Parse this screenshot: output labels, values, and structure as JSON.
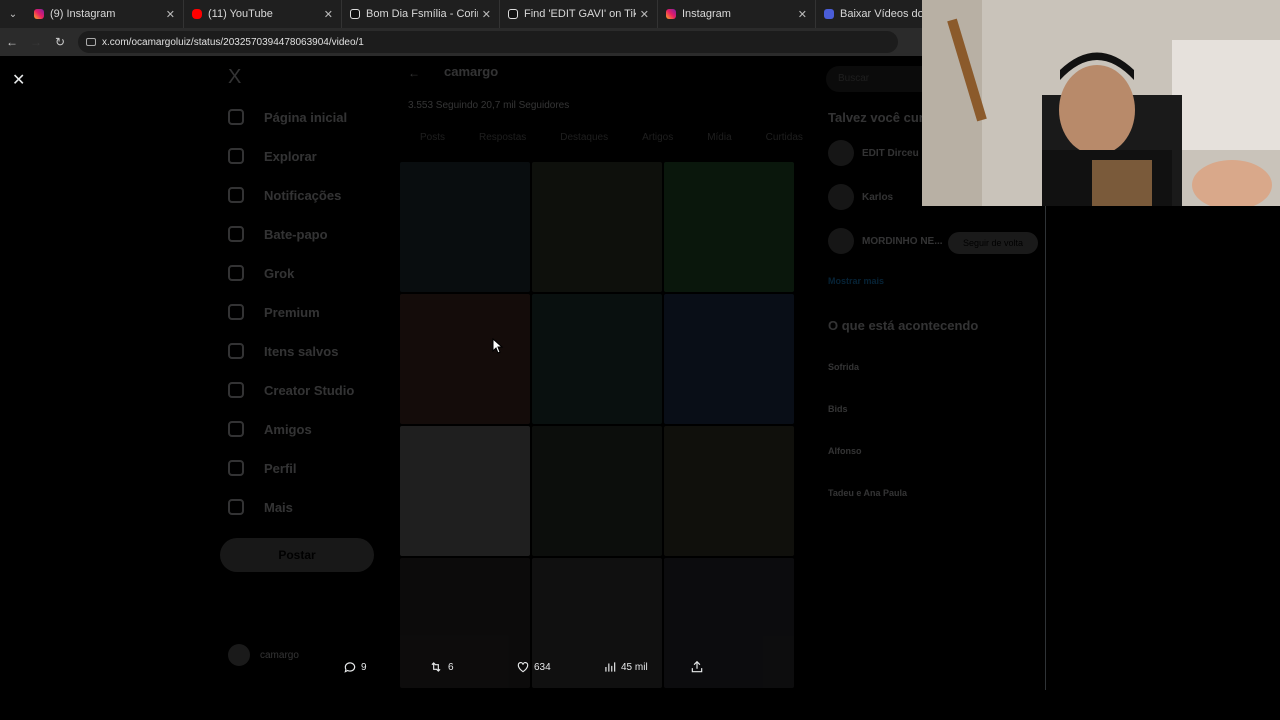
{
  "browser": {
    "tabs": [
      {
        "title": "(9) Instagram",
        "favicon": "instagram-icon"
      },
      {
        "title": "(11) YouTube",
        "favicon": "youtube-icon"
      },
      {
        "title": "Bom Dia Fsmília - Corintianos",
        "favicon": "tiktok-icon"
      },
      {
        "title": "Find 'EDIT GAVI' on TikTok | Tik",
        "favicon": "tiktok-icon"
      },
      {
        "title": "Instagram",
        "favicon": "instagram-icon"
      },
      {
        "title": "Baixar Vídeos do Instag",
        "favicon": "site-icon"
      }
    ],
    "url": "x.com/ocamargoluiz/status/2032570394478063904/video/1"
  },
  "sidebar": {
    "logo": "X",
    "items": [
      {
        "label": "Página inicial"
      },
      {
        "label": "Explorar"
      },
      {
        "label": "Notificações"
      },
      {
        "label": "Bate-papo"
      },
      {
        "label": "Grok"
      },
      {
        "label": "Premium"
      },
      {
        "label": "Itens salvos"
      },
      {
        "label": "Creator Studio"
      },
      {
        "label": "Amigos"
      },
      {
        "label": "Perfil"
      },
      {
        "label": "Mais"
      }
    ],
    "post_label": "Postar",
    "profile_name": "camargo"
  },
  "center": {
    "profile_name": "camargo",
    "stats": "3.553 Seguindo   20,7 mil Seguidores",
    "tabs": [
      "Posts",
      "Respostas",
      "Destaques",
      "Artigos",
      "Mídia",
      "Curtidas"
    ]
  },
  "right": {
    "search_placeholder": "Buscar",
    "suggest_title": "Talvez você curta",
    "suggestions": [
      "EDIT Dirceu",
      "Karlos",
      "MORDINHO NE..."
    ],
    "follow_label": "Seguir de volta",
    "show_more": "Mostrar mais",
    "trends_title": "O que está acontecendo",
    "trends": [
      "Sofrida",
      "Bids",
      "Alfonso",
      "Tadeu e Ana Paula"
    ]
  },
  "actions": {
    "replies": "9",
    "reposts": "6",
    "likes": "634",
    "views": "45 mil"
  },
  "colors": {
    "background": "#000000",
    "text": "#e7e9ea",
    "tabbar": "#1f1f1f",
    "addressbar": "#2b2b2b"
  }
}
